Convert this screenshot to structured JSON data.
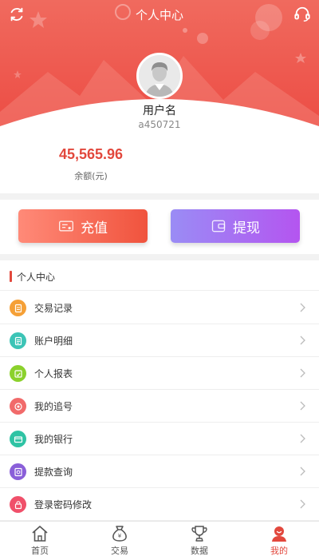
{
  "header": {
    "title": "个人中心",
    "colors": {
      "top": "#f0645a",
      "bottom": "#ee4d45"
    }
  },
  "user": {
    "name": "用户名",
    "id": "a450721"
  },
  "balance": {
    "amount": "45,565.96",
    "label": "余额(元)",
    "color": "#e2483d"
  },
  "actions": {
    "recharge_label": "充值",
    "withdraw_label": "提现"
  },
  "section": {
    "title": "个人中心"
  },
  "menu": [
    {
      "label": "交易记录",
      "icon": "document-icon",
      "color": "#f5a037"
    },
    {
      "label": "账户明细",
      "icon": "list-icon",
      "color": "#3cc4b6"
    },
    {
      "label": "个人报表",
      "icon": "report-icon",
      "color": "#8bd12c"
    },
    {
      "label": "我的追号",
      "icon": "tracking-icon",
      "color": "#f16a6a"
    },
    {
      "label": "我的银行",
      "icon": "bank-card-icon",
      "color": "#2fc3a4"
    },
    {
      "label": "提款查询",
      "icon": "withdraw-query-icon",
      "color": "#8a5fd9"
    },
    {
      "label": "登录密码修改",
      "icon": "lock-icon",
      "color": "#f0506a"
    }
  ],
  "tabs": [
    {
      "label": "首页",
      "icon": "home-icon",
      "active": false
    },
    {
      "label": "交易",
      "icon": "money-bag-icon",
      "active": false
    },
    {
      "label": "数据",
      "icon": "trophy-icon",
      "active": false
    },
    {
      "label": "我的",
      "icon": "profile-icon",
      "active": true
    }
  ],
  "accent": "#e2483d"
}
